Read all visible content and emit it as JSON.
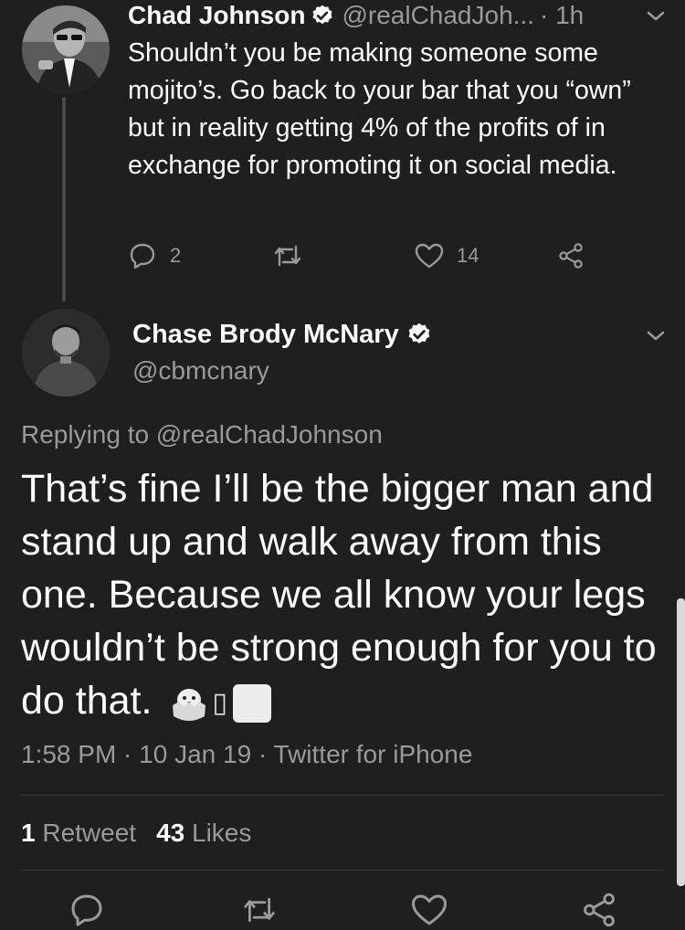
{
  "parent_tweet": {
    "name": "Chad Johnson",
    "handle": "@realChadJoh...",
    "time": "· 1h",
    "text": "Shouldn’t you be making someone some mojito’s. Go back to your bar that you “own” but in reality getting 4% of the profits of in exchange for promoting it on social media.",
    "replies": "2",
    "retweets": "",
    "likes": "14",
    "icons": {
      "reply": "reply-icon",
      "retweet": "retweet-icon",
      "like": "like-icon",
      "share": "share-icon"
    }
  },
  "main_tweet": {
    "name": "Chase Brody McNary",
    "handle": "@cbmcnary",
    "replying_to": "Replying to @realChadJohnson",
    "text": "That’s fine I’ll be the bigger man and stand up and walk away from this one.  Because we all know your legs wouldn’t be strong enough for you to do that.",
    "emoji_glyph": "▯",
    "meta": "1:58 PM · 10 Jan 19 · Twitter for iPhone",
    "retweet_count": "1",
    "retweet_label": "Retweet",
    "like_count": "43",
    "like_label": "Likes"
  },
  "colors": {
    "background": "#1f1f1f",
    "primary_text": "#ffffff",
    "secondary_text": "#9a9a9a",
    "divider": "#3a3a3a"
  }
}
